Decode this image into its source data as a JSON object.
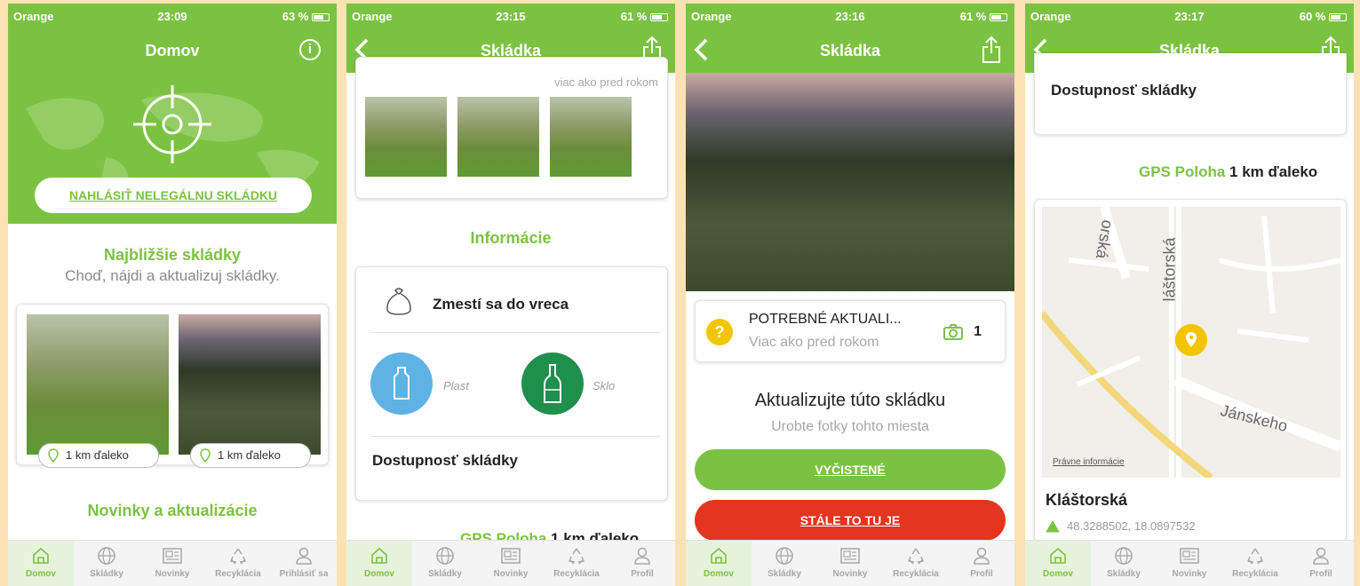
{
  "status": {
    "carrier": "Orange",
    "screen1": {
      "time": "23:09",
      "battery": "63 %"
    },
    "screen2": {
      "time": "23:15",
      "battery": "61 %"
    },
    "screen3": {
      "time": "23:16",
      "battery": "61 %"
    },
    "screen4": {
      "time": "23:17",
      "battery": "60 %"
    }
  },
  "screen1": {
    "title": "Domov",
    "report_button": "NAHLÁSIŤ NELEGÁLNU SKLÁDKU",
    "nearest_title": "Najbližšie skládky",
    "nearest_subtitle": "Choď, nájdi a aktualizuj skládky.",
    "distance_1": "1 km ďaleko",
    "distance_2": "1 km ďaleko",
    "news_title": "Novinky a aktualizácie"
  },
  "screen2": {
    "title": "Skládka",
    "updated_text": "viac ako pred rokom",
    "info_title": "Informácie",
    "size_label": "Zmestí sa do vreca",
    "type_plastic": "Plast",
    "type_glass": "Sklo",
    "access_label": "Dostupnosť skládky",
    "gps_label": "GPS Poloha",
    "gps_distance": "1 km ďaleko"
  },
  "screen3": {
    "title": "Skládka",
    "status_title": "POTREBNÉ AKTUALI...",
    "status_sub": "Viac ako pred rokom",
    "photo_count": "1",
    "update_title": "Aktualizujte túto skládku",
    "update_sub": "Urobte fotky tohto miesta",
    "btn_clean": "VYČISTENÉ",
    "btn_still": "STÁLE TO TU JE"
  },
  "screen4": {
    "title": "Skládka",
    "access_label": "Dostupnosť skládky",
    "gps_label": "GPS Poloha",
    "gps_distance": "1 km ďaleko",
    "map_street_1": "orská",
    "map_street_2": "láštorská",
    "map_street_3": "Jánskeho",
    "map_legal": "Právne informácie",
    "address": "Kláštorská",
    "coordinates": "48.3288502, 18.0897532"
  },
  "tabs": {
    "home": "Domov",
    "dumps": "Skládky",
    "news": "Novinky",
    "recycling": "Recyklácia",
    "login": "Prihlásiť sa",
    "profile": "Profil"
  },
  "colors": {
    "brand_green": "#7cc242",
    "dark_green": "#1f8f4c",
    "plastic_blue": "#5eb3e4",
    "danger_red": "#e3351f",
    "warning_yellow": "#f2c500"
  }
}
